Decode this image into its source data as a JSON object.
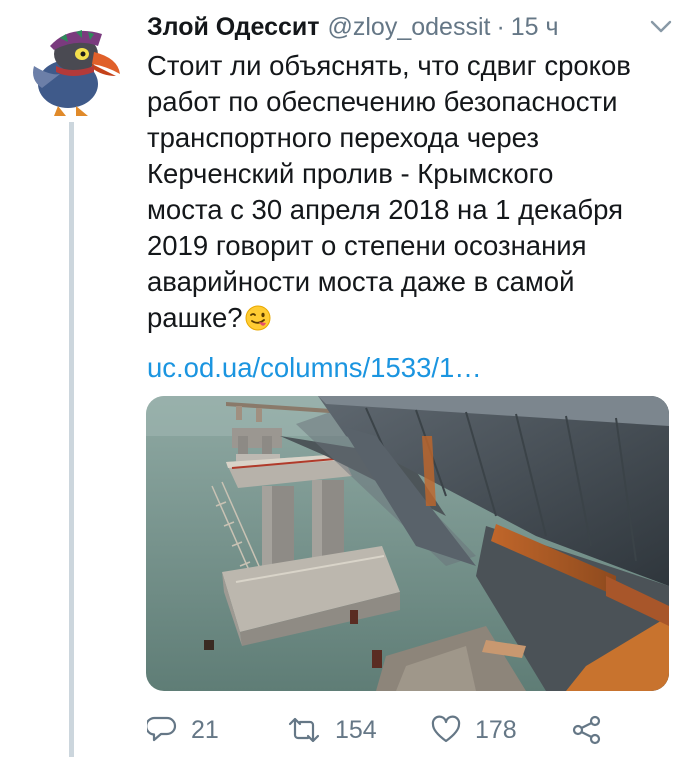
{
  "tweet": {
    "author_name": "Злой Одессит",
    "author_handle": "@zloy_odessit",
    "separator": "·",
    "time": "15 ч",
    "text_lines": [
      "Стоит ли объяснять, что сдвиг сроков",
      "работ по обеспечению безопасности",
      "транспортного перехода через",
      "Керченский пролив - Крымского",
      "моста с 30 апреля 2018 на 1 декабря",
      "2019 говорит о степени осознания",
      "аварийности моста даже в самой",
      "рашке?"
    ],
    "link": "uc.od.ua/columns/1533/1…"
  },
  "actions": {
    "replies": "21",
    "retweets": "154",
    "likes": "178"
  },
  "colors": {
    "text": "#14171a",
    "secondary": "#657786",
    "link": "#1b95e0",
    "thread_line": "#ccd6dd"
  },
  "icons": [
    "chevron-down-icon",
    "winking-tongue-emoji-icon",
    "reply-icon",
    "retweet-icon",
    "like-icon",
    "share-icon"
  ]
}
